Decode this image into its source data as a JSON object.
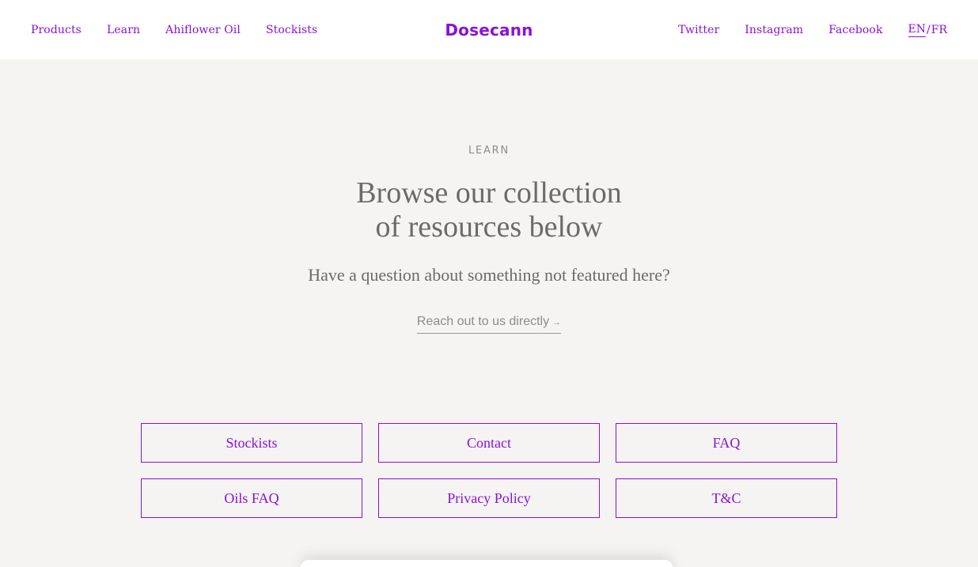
{
  "header": {
    "logo": "Dosecann",
    "nav_left": [
      "Products",
      "Learn",
      "Ahiflower Oil",
      "Stockists"
    ],
    "nav_right": [
      "Twitter",
      "Instagram",
      "Facebook"
    ],
    "lang": {
      "active": "EN",
      "separator": "/",
      "other": "FR"
    }
  },
  "hero": {
    "eyebrow": "LEARN",
    "headline_line1": "Browse our collection",
    "headline_line2": "of resources below",
    "subline": "Have a question about something not featured here?",
    "cta_label": "Reach out to us directly",
    "cta_arrow": "→"
  },
  "tiles": [
    "Stockists",
    "Contact",
    "FAQ",
    "Oils FAQ",
    "Privacy Policy",
    "T&C"
  ],
  "colors": {
    "accent": "#8a11d9",
    "background": "#f5f4f2",
    "text": "#6b6b6b"
  }
}
